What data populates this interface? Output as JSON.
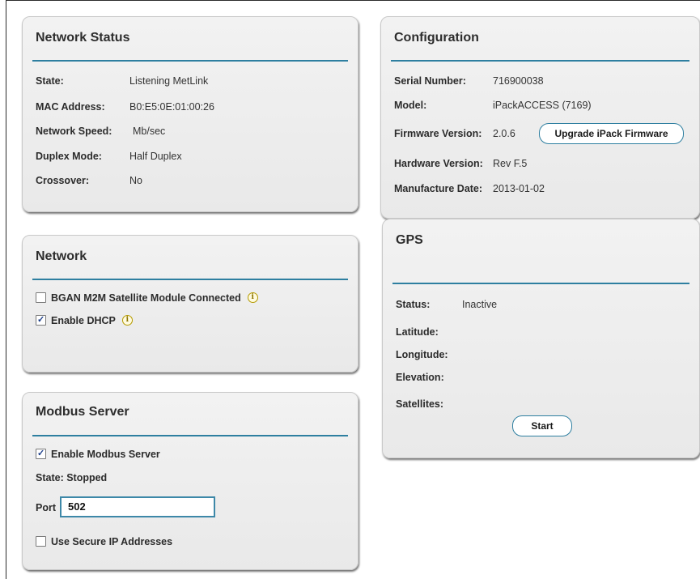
{
  "network_status": {
    "title": "Network Status",
    "rows": [
      {
        "label": "State:",
        "value": "Listening MetLink"
      },
      {
        "label": "MAC Address:",
        "value": "B0:E5:0E:01:00:26"
      },
      {
        "label": "Network Speed:",
        "value": "Mb/sec"
      },
      {
        "label": "Duplex Mode:",
        "value": "Half Duplex"
      },
      {
        "label": "Crossover:",
        "value": "No"
      }
    ]
  },
  "configuration": {
    "title": "Configuration",
    "serial_label": "Serial Number:",
    "serial_value": "716900038",
    "model_label": "Model:",
    "model_value": "iPackACCESS (7169)",
    "firmware_label": "Firmware Version:",
    "firmware_value": "2.0.6",
    "upgrade_button": "Upgrade iPack Firmware",
    "hardware_label": "Hardware Version:",
    "hardware_value": "Rev F.5",
    "manufacture_label": "Manufacture Date:",
    "manufacture_value": "2013-01-02"
  },
  "network": {
    "title": "Network",
    "bgan_label": "BGAN M2M Satellite Module Connected",
    "bgan_checked": false,
    "dhcp_label": "Enable DHCP",
    "dhcp_checked": true
  },
  "gps": {
    "title": "GPS",
    "status_label": "Status:",
    "status_value": "Inactive",
    "latitude_label": "Latitude:",
    "longitude_label": "Longitude:",
    "elevation_label": "Elevation:",
    "satellites_label": "Satellites:",
    "start_button": "Start"
  },
  "modbus": {
    "title": "Modbus Server",
    "enable_label": "Enable Modbus Server",
    "enable_checked": true,
    "state_text": "State: Stopped",
    "port_label": "Port",
    "port_value": "502",
    "secure_label": "Use Secure IP Addresses",
    "secure_checked": false
  },
  "colors": {
    "accent": "#2e7fa0",
    "panel_bg": "#ececec"
  }
}
